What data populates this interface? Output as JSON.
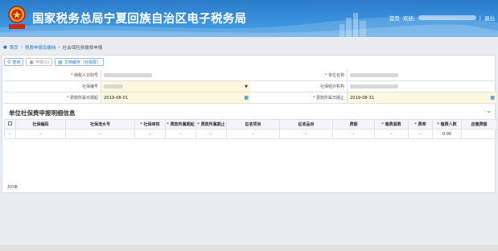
{
  "header": {
    "title": "国家税务总局宁夏回族自治区电子税务局",
    "home": "首页",
    "greeting": "欢迎,",
    "logout": "退出",
    "emblem_label": "中国税务"
  },
  "breadcrumb": {
    "home": "首页",
    "parent": "税费申报及缴纳",
    "current": "社会保险费缴费申报"
  },
  "toolbar": {
    "query": "查询",
    "submit": "申报(S)",
    "print": "文档缓存（社保费）"
  },
  "form": {
    "taxpayer_id_label": "纳税人识别号",
    "unit_name_label": "单位名称",
    "social_security_no_label": "社保编号",
    "agency_label": "社保经办机构",
    "period_start_label": "费款所属日期起",
    "period_start_value": "2019-08-01",
    "period_end_label": "费款所属日期止",
    "period_end_value": "2019-08-31"
  },
  "section": {
    "title": "单位社保费申报明细信息"
  },
  "table": {
    "headers": [
      "社保编码",
      "社保流水号",
      "社保审核",
      "费款所属期起",
      "费款所属期止",
      "征收项目",
      "征收品目",
      "费额",
      "缴费基数",
      "费率",
      "缴费人数",
      "应缴费额"
    ],
    "required": [
      false,
      false,
      true,
      true,
      true,
      false,
      false,
      false,
      true,
      true,
      true,
      false
    ],
    "row": [
      "-",
      "-",
      "-",
      "-",
      "-",
      "-",
      "-",
      "-",
      "-",
      "-",
      "-",
      "0.00"
    ]
  },
  "footer": {
    "total": "共0条"
  },
  "colors": {
    "header_bg": "#3b93dc",
    "accent": "#2b78c5",
    "required": "#e33333",
    "input_highlight": "#fdf8dd"
  }
}
